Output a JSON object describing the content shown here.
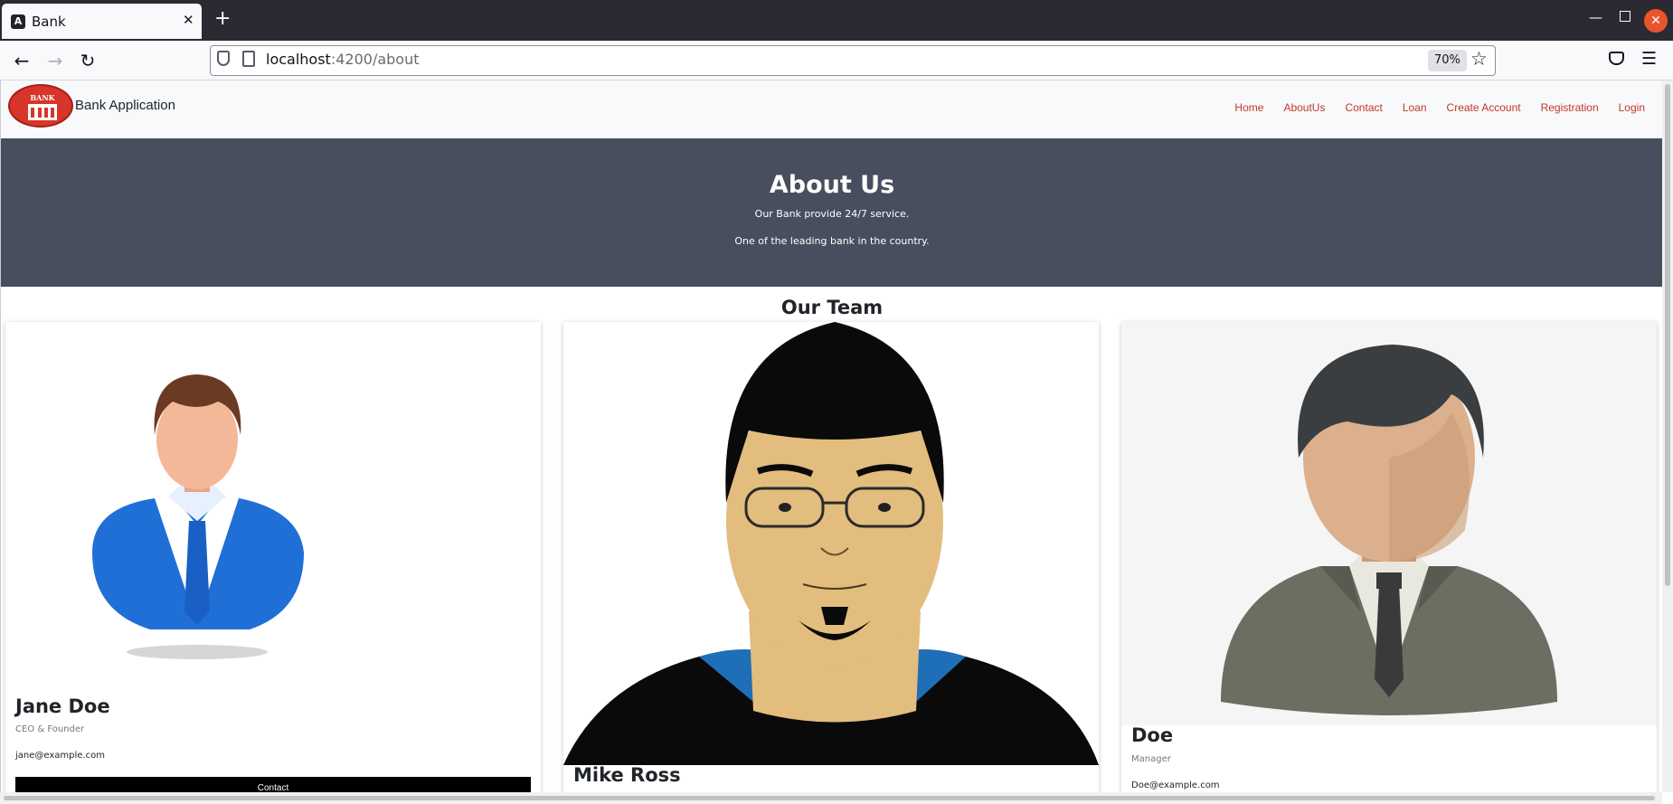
{
  "browser": {
    "tab_title": "Bank",
    "url_host": "localhost",
    "url_rest": ":4200/about",
    "zoom": "70%"
  },
  "header": {
    "brand": "Bank Application",
    "logo_text": "BANK",
    "nav": [
      "Home",
      "AboutUs",
      "Contact",
      "Loan",
      "Create Account",
      "Registration",
      "Login"
    ]
  },
  "hero": {
    "title": "About Us",
    "line1": "Our Bank provide 24/7 service.",
    "line2": "One of the leading bank in the country."
  },
  "team": {
    "title": "Our Team",
    "members": [
      {
        "name": "Jane Doe",
        "role": "CEO & Founder",
        "email": "jane@example.com",
        "button": "Contact"
      },
      {
        "name": "Mike Ross",
        "role": "",
        "email": "",
        "button": ""
      },
      {
        "name": "Doe",
        "role": "Manager",
        "email": "Doe@example.com",
        "button": ""
      }
    ]
  }
}
